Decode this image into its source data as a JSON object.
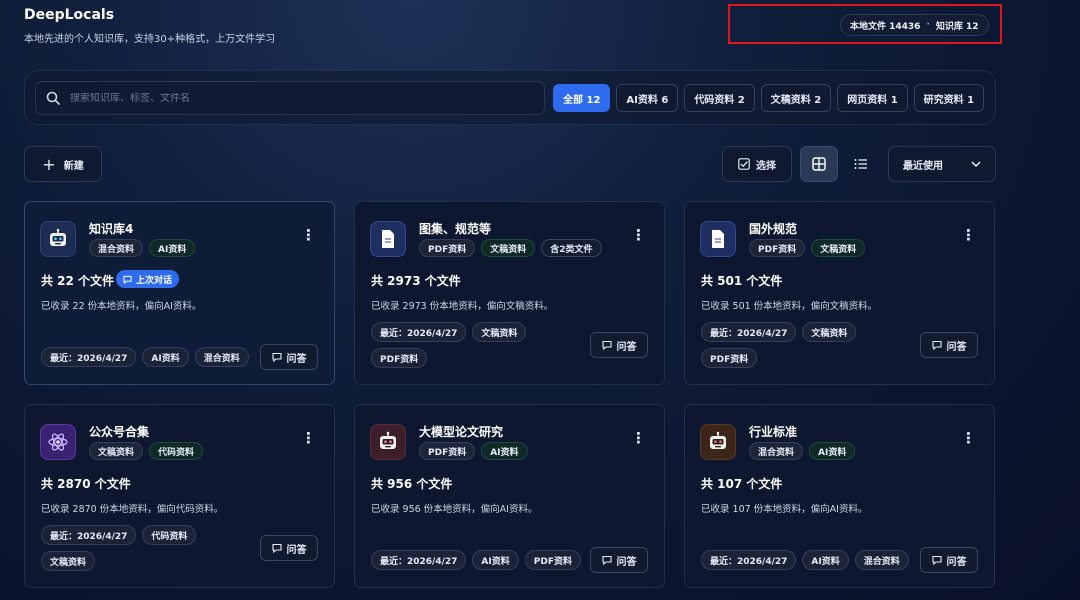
{
  "header": {
    "app_title": "DeepLocals",
    "subtitle": "本地先进的个人知识库，支持30+种格式，上万文件学习",
    "stats": {
      "local_files": "本地文件 14436",
      "separator": "·",
      "libraries": "知识库 12"
    }
  },
  "search": {
    "placeholder": "搜索知识库、标签、文件名",
    "value": ""
  },
  "filters": [
    {
      "label": "全部 12",
      "active": true
    },
    {
      "label": "AI资料 6",
      "active": false
    },
    {
      "label": "代码资料 2",
      "active": false
    },
    {
      "label": "文稿资料 2",
      "active": false
    },
    {
      "label": "网页资料 1",
      "active": false
    },
    {
      "label": "研究资料 1",
      "active": false
    }
  ],
  "toolbar": {
    "new_label": "新建",
    "select_label": "选择",
    "sort_label": "最近使用"
  },
  "cards": [
    {
      "title": "知识库4",
      "icon": "robot-icon",
      "tags": [
        "混合资料",
        "AI资料"
      ],
      "count": "共 22 个文件",
      "last_chat": "上次对话",
      "desc": "已收录 22 份本地资料，偏向AI资料。",
      "meta": [
        "最近：2026/4/27",
        "AI资料",
        "混合资料"
      ],
      "qa": "问答"
    },
    {
      "title": "图集、规范等",
      "icon": "document-icon",
      "tags": [
        "PDF资料",
        "文稿资料",
        "含2类文件"
      ],
      "count": "共 2973 个文件",
      "desc": "已收录 2973 份本地资料，偏向文稿资料。",
      "meta": [
        "最近：2026/4/27",
        "文稿资料",
        "PDF资料"
      ],
      "qa": "问答"
    },
    {
      "title": "国外规范",
      "icon": "document-icon",
      "tags": [
        "PDF资料",
        "文稿资料"
      ],
      "count": "共 501 个文件",
      "desc": "已收录 501 份本地资料，偏向文稿资料。",
      "meta": [
        "最近：2026/4/27",
        "文稿资料",
        "PDF资料"
      ],
      "qa": "问答"
    },
    {
      "title": "公众号合集",
      "icon": "atom-icon",
      "tags": [
        "文稿资料",
        "代码资料"
      ],
      "count": "共 2870 个文件",
      "desc": "已收录 2870 份本地资料，偏向代码资料。",
      "meta": [
        "最近：2026/4/27",
        "代码资料",
        "文稿资料"
      ],
      "qa": "问答"
    },
    {
      "title": "大模型论文研究",
      "icon": "robot-icon",
      "tags": [
        "PDF资料",
        "AI资料"
      ],
      "count": "共 956 个文件",
      "desc": "已收录 956 份本地资料，偏向AI资料。",
      "meta": [
        "最近：2026/4/27",
        "AI资料",
        "PDF资料"
      ],
      "qa": "问答"
    },
    {
      "title": "行业标准",
      "icon": "robot-icon",
      "tags": [
        "混合资料",
        "AI资料"
      ],
      "count": "共 107 个文件",
      "desc": "已收录 107 份本地资料，偏向AI资料。",
      "meta": [
        "最近：2026/4/27",
        "AI资料",
        "混合资料"
      ],
      "qa": "问答"
    }
  ],
  "colors": {
    "accent": "#2f6bef",
    "highlight_box": "#e0161c",
    "background": "#0b1630"
  }
}
